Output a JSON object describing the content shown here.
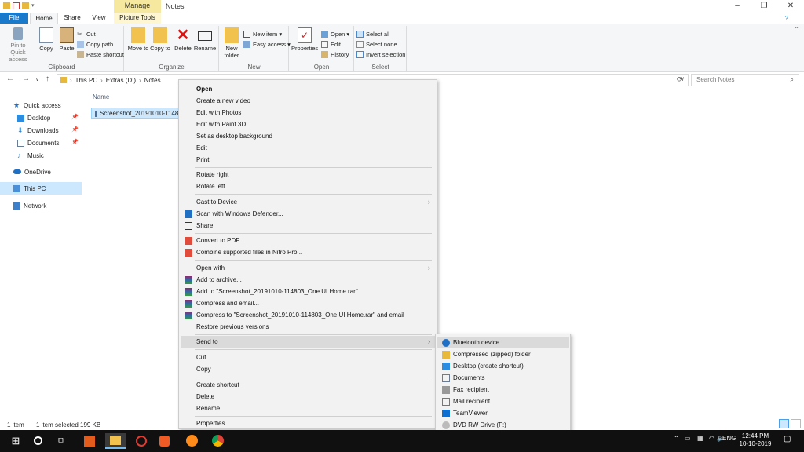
{
  "window": {
    "title": "Notes",
    "manage_tab": "Manage",
    "controls": [
      "–",
      "❐",
      "✕"
    ]
  },
  "ribbon_tabs": {
    "file": "File",
    "home": "Home",
    "share": "Share",
    "view": "View",
    "picture_tools": "Picture Tools"
  },
  "ribbon": {
    "clipboard": {
      "label": "Clipboard",
      "pin": "Pin to Quick access",
      "copy": "Copy",
      "paste": "Paste",
      "cut": "Cut",
      "copy_path": "Copy path",
      "paste_shortcut": "Paste shortcut"
    },
    "organize": {
      "label": "Organize",
      "move_to": "Move to",
      "copy_to": "Copy to",
      "delete": "Delete",
      "rename": "Rename"
    },
    "new": {
      "label": "New",
      "new_folder": "New folder",
      "new_item": "New item ▾",
      "easy_access": "Easy access ▾"
    },
    "open": {
      "label": "Open",
      "properties": "Properties",
      "open": "Open ▾",
      "edit": "Edit",
      "history": "History"
    },
    "select": {
      "label": "Select",
      "select_all": "Select all",
      "select_none": "Select none",
      "invert_selection": "Invert selection"
    }
  },
  "address": {
    "crumbs": [
      "This PC",
      "Extras (D:)",
      "Notes"
    ],
    "search_placeholder": "Search Notes"
  },
  "nav": {
    "quick_access": "Quick access",
    "desktop": "Desktop",
    "downloads": "Downloads",
    "documents": "Documents",
    "music": "Music",
    "onedrive": "OneDrive",
    "this_pc": "This PC",
    "network": "Network"
  },
  "content": {
    "column_name": "Name",
    "file_name": "Screenshot_20191010-114803"
  },
  "status": {
    "count": "1 item",
    "selected": "1 item selected  199 KB"
  },
  "context_menu": {
    "open": "Open",
    "create_video": "Create a new video",
    "edit_photos": "Edit with Photos",
    "edit_paint3d": "Edit with Paint 3D",
    "set_background": "Set as desktop background",
    "edit": "Edit",
    "print": "Print",
    "rotate_right": "Rotate right",
    "rotate_left": "Rotate left",
    "cast": "Cast to Device",
    "scan": "Scan with Windows Defender...",
    "share": "Share",
    "convert_pdf": "Convert to PDF",
    "combine_nitro": "Combine supported files in Nitro Pro...",
    "open_with": "Open with",
    "add_archive": "Add to archive...",
    "add_rar": "Add to \"Screenshot_20191010-114803_One UI Home.rar\"",
    "compress_email": "Compress and email...",
    "compress_rar_email": "Compress to \"Screenshot_20191010-114803_One UI Home.rar\" and email",
    "restore": "Restore previous versions",
    "send_to": "Send to",
    "cut": "Cut",
    "copy": "Copy",
    "create_shortcut": "Create shortcut",
    "delete": "Delete",
    "rename": "Rename",
    "properties": "Properties"
  },
  "send_to_menu": {
    "bluetooth": "Bluetooth device",
    "compressed": "Compressed (zipped) folder",
    "desktop": "Desktop (create shortcut)",
    "documents": "Documents",
    "fax": "Fax recipient",
    "mail": "Mail recipient",
    "teamviewer": "TeamViewer",
    "dvd": "DVD RW Drive (F:)"
  },
  "taskbar": {
    "tray_lang": "ENG",
    "time": "12:44 PM",
    "date": "10-10-2019"
  },
  "colors": {
    "accent": "#1979ca",
    "selection": "#cce8ff",
    "manage": "#f7e8a0",
    "taskbar": "#101010"
  }
}
